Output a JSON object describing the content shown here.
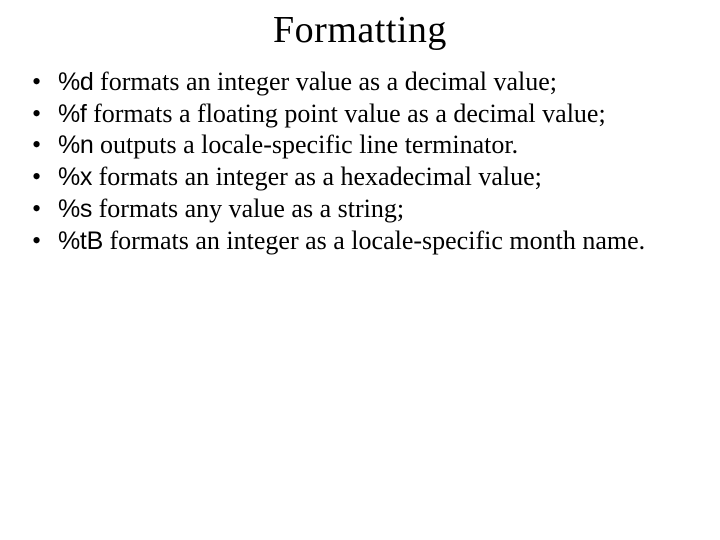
{
  "slide": {
    "title": "Formatting",
    "items": [
      {
        "code": "%d",
        "desc": " formats an integer value as a decimal value;"
      },
      {
        "code": "%f",
        "desc": " formats a floating point value as a decimal value;"
      },
      {
        "code": "%n",
        "desc": " outputs a locale-specific line terminator."
      },
      {
        "code": "%x",
        "desc": " formats an integer as a hexadecimal value;"
      },
      {
        "code": "%s",
        "desc": " formats any value as a string;"
      },
      {
        "code": "%tB",
        "desc": " formats an integer as a locale-specific month name."
      }
    ]
  }
}
